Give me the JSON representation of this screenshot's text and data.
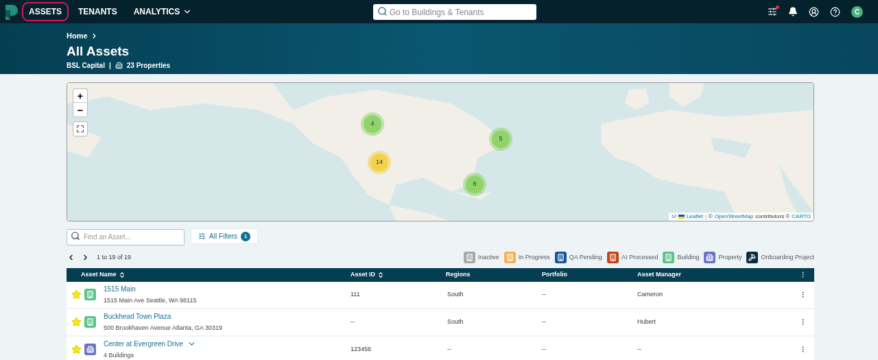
{
  "nav": {
    "items": [
      {
        "label": "ASSETS",
        "selected": true,
        "dropdown": false
      },
      {
        "label": "TENANTS",
        "selected": false,
        "dropdown": false
      },
      {
        "label": "ANALYTICS",
        "selected": false,
        "dropdown": true
      }
    ],
    "search": {
      "placeholder": "Go to Buildings & Tenants"
    },
    "avatar": "C",
    "has_notification": true
  },
  "header": {
    "breadcrumb": "Home",
    "title": "All Assets",
    "company": "BSL Capital",
    "separator": "|",
    "properties": "23 Properties"
  },
  "map": {
    "zoom_in": "+",
    "zoom_out": "−",
    "clusters": [
      {
        "count": "4",
        "color": "#8fd46b"
      },
      {
        "count": "14",
        "color": "#f1d24a"
      },
      {
        "count": "5",
        "color": "#8fd46b"
      },
      {
        "count": "8",
        "color": "#8fd46b"
      }
    ],
    "attribution": {
      "m": "M",
      "leaflet": "Leaflet",
      "sep": "|",
      "copy": "©",
      "osm": "OpenStreetMap",
      "contrib": "contributors ©",
      "carto": "CARTO"
    }
  },
  "toolbar": {
    "search_placeholder": "Find an Asset...",
    "filters_label": "All Filters",
    "filters_count": "1",
    "pagination": "1 to 19 of 19"
  },
  "legend": [
    {
      "label": "Inactive",
      "kind": "building",
      "color": "#a6a6a6"
    },
    {
      "label": "In Progress",
      "kind": "building",
      "color": "#f5b04f"
    },
    {
      "label": "QA Pending",
      "kind": "building",
      "color": "#15559a"
    },
    {
      "label": "AI Processed",
      "kind": "building",
      "color": "#c94016"
    },
    {
      "label": "Building",
      "kind": "building",
      "color": "#5cc38a"
    },
    {
      "label": "Property",
      "kind": "property",
      "color": "#6b73c6"
    },
    {
      "label": "Onboarding Project",
      "kind": "hammer",
      "color": "#0b2c3c"
    }
  ],
  "table": {
    "columns": [
      {
        "label": "Asset Name",
        "sortable": true
      },
      {
        "label": "Asset ID",
        "sortable": true
      },
      {
        "label": "Regions",
        "sortable": false
      },
      {
        "label": "Portfolio",
        "sortable": false
      },
      {
        "label": "Asset Manager",
        "sortable": false
      }
    ],
    "rows": [
      {
        "name": "1515 Main",
        "subtitle": "1515 Main Ave Seattle, WA 98115",
        "kind": "building",
        "favorite": true,
        "expandable": false,
        "id": "111",
        "region": "South",
        "portfolio": "--",
        "manager": "Cameron"
      },
      {
        "name": "Buckhead Town Plaza",
        "subtitle": "500 Brookhaven Avenue Atlanta, GA 30319",
        "kind": "building",
        "favorite": true,
        "expandable": false,
        "id": "--",
        "region": "South",
        "portfolio": "--",
        "manager": "Hubert"
      },
      {
        "name": "Center at Evergreen Drive",
        "subtitle": "4 Buildings",
        "kind": "property",
        "favorite": true,
        "expandable": true,
        "id": "123456",
        "region": "--",
        "portfolio": "--",
        "manager": "--"
      }
    ]
  }
}
